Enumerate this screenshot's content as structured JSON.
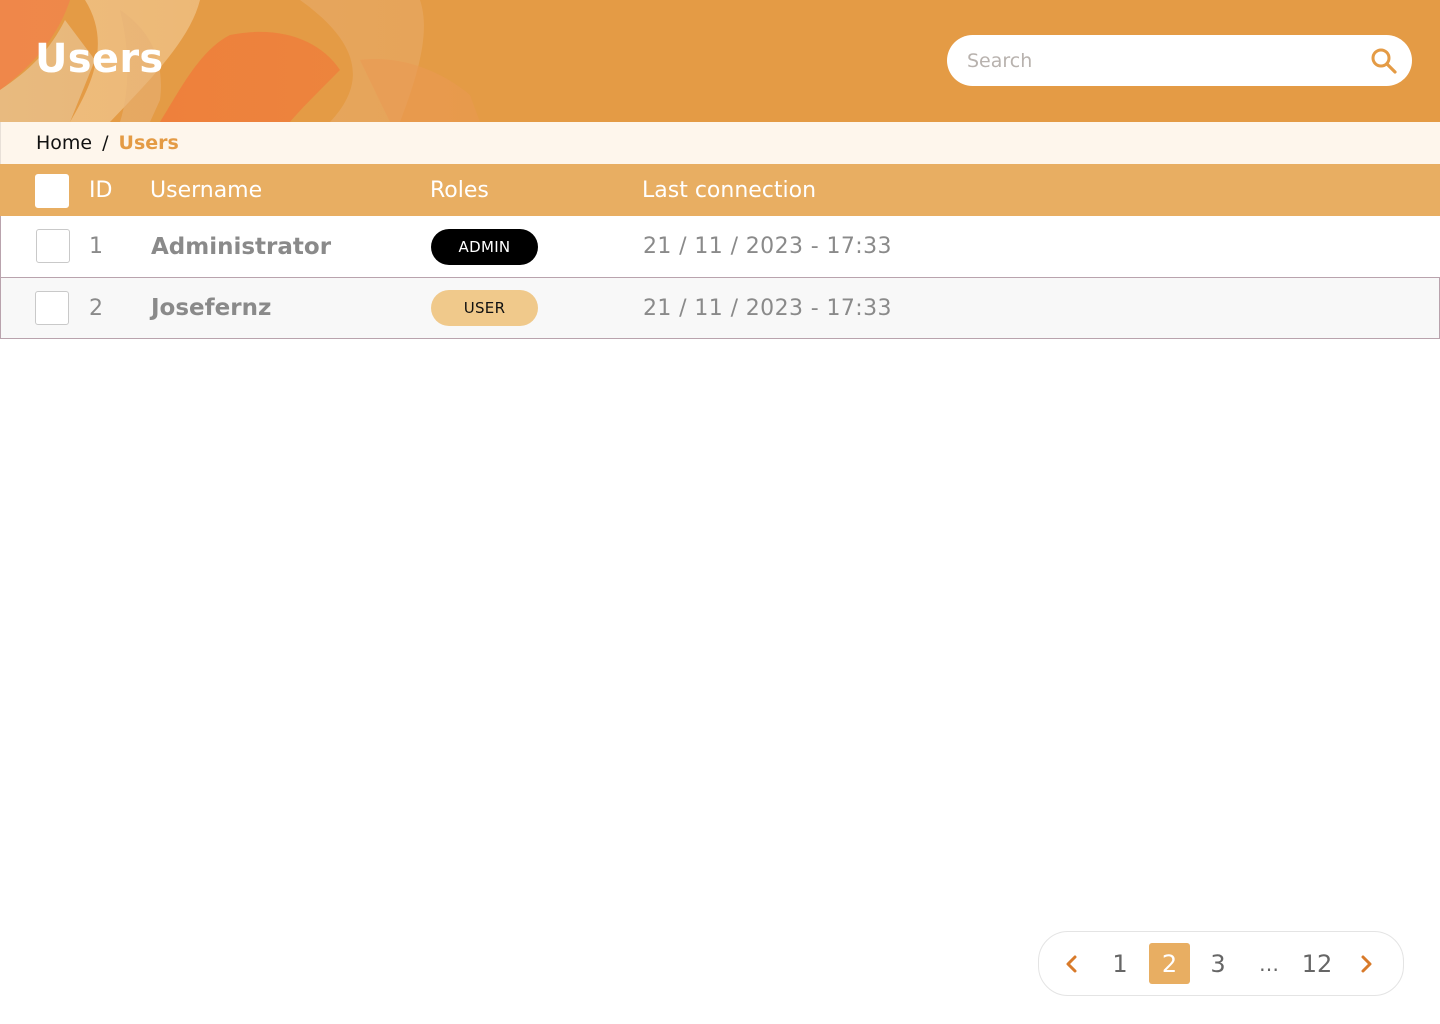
{
  "header": {
    "title": "Users",
    "search": {
      "placeholder": "Search",
      "value": ""
    }
  },
  "breadcrumb": {
    "home": "Home",
    "separator": "/",
    "current": "Users"
  },
  "table": {
    "columns": {
      "id": "ID",
      "username": "Username",
      "roles": "Roles",
      "last_connection": "Last connection"
    },
    "rows": [
      {
        "id": "1",
        "username": "Administrator",
        "role": "ADMIN",
        "last_connection": "21 / 11 / 2023 - 17:33",
        "checked": false
      },
      {
        "id": "2",
        "username": "Josefernz",
        "role": "USER",
        "last_connection": "21 / 11 / 2023 - 17:33",
        "checked": false
      }
    ]
  },
  "pagination": {
    "pages": [
      "1",
      "2",
      "3",
      "…",
      "12"
    ],
    "current": "2"
  },
  "colors": {
    "header_bg": "#e49b45",
    "table_head_bg": "#e8ae62",
    "breadcrumb_bg": "#fef6ec",
    "accent": "#e49b45",
    "admin_badge": "#000000",
    "user_badge": "#f0c98b"
  },
  "icons": {
    "search": "search-icon",
    "prev": "chevron-left-icon",
    "next": "chevron-right-icon"
  }
}
